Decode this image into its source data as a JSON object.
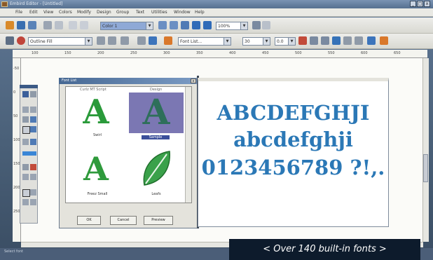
{
  "window": {
    "title": "Embird Editor - [Untitled]"
  },
  "menu": [
    "File",
    "Edit",
    "View",
    "Colors",
    "Modify",
    "Design",
    "Group",
    "Text",
    "Utilities",
    "Window",
    "Help"
  ],
  "toolbar": {
    "color_value": "Color 1",
    "zoom_value": "100%",
    "color_combo": "Outline Fill",
    "font_combo": "Font List...",
    "size_value": "30",
    "spacing_value": "0.0"
  },
  "ruler": {
    "h_labels": [
      "100",
      "150",
      "200",
      "250",
      "300",
      "350",
      "400",
      "450",
      "500",
      "550",
      "600",
      "650"
    ],
    "v_labels": [
      "-50",
      "0",
      "50",
      "100",
      "150",
      "200",
      "250"
    ]
  },
  "dialog": {
    "title": "Font List",
    "fonts": [
      {
        "header": "Curlz MT Script",
        "caption": "Swirl",
        "sample": "A",
        "glyph_color": "#2a9a3a",
        "bg": "#ffffff"
      },
      {
        "header": "Design",
        "caption": "Sample",
        "sample": "A",
        "glyph_color": "#2e6f5a",
        "bg": "#7b77b3"
      },
      {
        "header": "",
        "caption": "Freez Small",
        "sample": "A",
        "glyph_color": "#2f9a3c",
        "bg": "#ffffff"
      },
      {
        "header": "",
        "caption": "Leafs",
        "sample": "",
        "glyph_color": "#3aa14a",
        "bg": "#ffffff"
      }
    ],
    "buttons": {
      "ok": "OK",
      "cancel": "Cancel",
      "preview": "Preview"
    }
  },
  "preview": {
    "line1": "ABCDEFGHJI",
    "line2": "abcdefghji",
    "line3": "0123456789  ?!,."
  },
  "status": {
    "text": "Select font"
  },
  "banner": {
    "text": "< Over 140 built-in fonts >"
  },
  "colors": {
    "accent": "#2b78b6",
    "glyph": "#2a9a3a",
    "title_bar": "#55708f"
  }
}
